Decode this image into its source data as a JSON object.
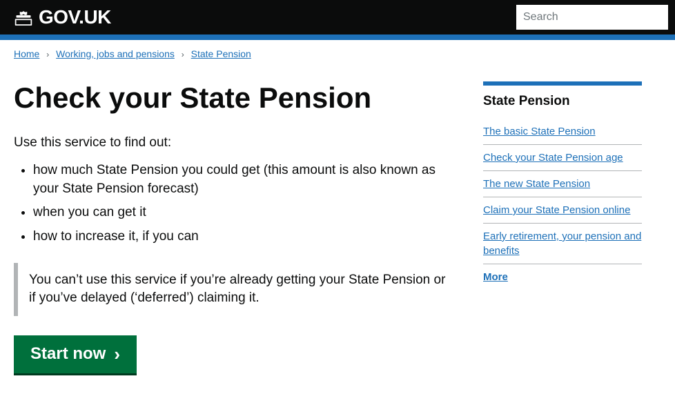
{
  "header": {
    "site_name": "GOV.UK",
    "search_placeholder": "Search"
  },
  "breadcrumb": {
    "items": [
      {
        "label": "Home",
        "href": "#"
      },
      {
        "label": "Working, jobs and pensions",
        "href": "#"
      },
      {
        "label": "State Pension",
        "href": "#"
      }
    ]
  },
  "main": {
    "page_title": "Check your State Pension",
    "description": "Use this service to find out:",
    "bullets": [
      "how much State Pension you could get (this amount is also known as your State Pension forecast)",
      "when you can get it",
      "how to increase it, if you can"
    ],
    "warning_text": "You can’t use this service if you’re already getting your State Pension or if you’ve delayed (‘deferred’) claiming it.",
    "start_button_label": "Start now"
  },
  "sidebar": {
    "title": "State Pension",
    "nav_items": [
      {
        "label": "The basic State Pension",
        "href": "#"
      },
      {
        "label": "Check your State Pension age",
        "href": "#"
      },
      {
        "label": "The new State Pension",
        "href": "#"
      },
      {
        "label": "Claim your State Pension online",
        "href": "#"
      },
      {
        "label": "Early retirement, your pension and benefits",
        "href": "#"
      }
    ],
    "more_label": "More"
  }
}
